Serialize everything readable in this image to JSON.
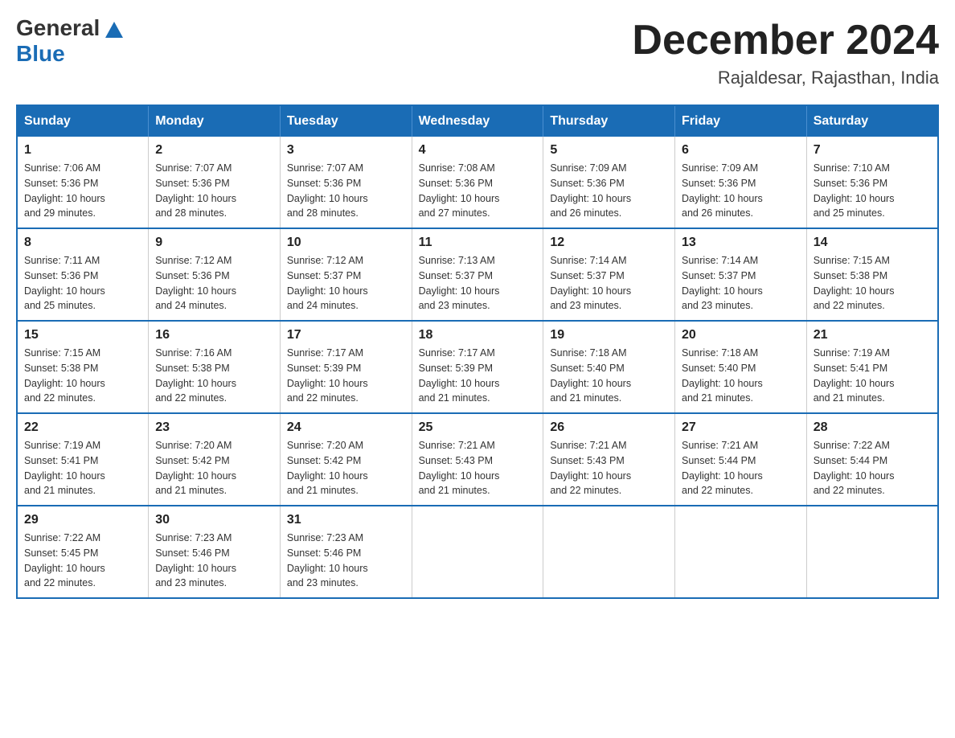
{
  "header": {
    "logo_general": "General",
    "logo_blue": "Blue",
    "month_year": "December 2024",
    "location": "Rajaldesar, Rajasthan, India"
  },
  "weekdays": [
    "Sunday",
    "Monday",
    "Tuesday",
    "Wednesday",
    "Thursday",
    "Friday",
    "Saturday"
  ],
  "weeks": [
    [
      {
        "day": "1",
        "sunrise": "7:06 AM",
        "sunset": "5:36 PM",
        "daylight": "10 hours and 29 minutes."
      },
      {
        "day": "2",
        "sunrise": "7:07 AM",
        "sunset": "5:36 PM",
        "daylight": "10 hours and 28 minutes."
      },
      {
        "day": "3",
        "sunrise": "7:07 AM",
        "sunset": "5:36 PM",
        "daylight": "10 hours and 28 minutes."
      },
      {
        "day": "4",
        "sunrise": "7:08 AM",
        "sunset": "5:36 PM",
        "daylight": "10 hours and 27 minutes."
      },
      {
        "day": "5",
        "sunrise": "7:09 AM",
        "sunset": "5:36 PM",
        "daylight": "10 hours and 26 minutes."
      },
      {
        "day": "6",
        "sunrise": "7:09 AM",
        "sunset": "5:36 PM",
        "daylight": "10 hours and 26 minutes."
      },
      {
        "day": "7",
        "sunrise": "7:10 AM",
        "sunset": "5:36 PM",
        "daylight": "10 hours and 25 minutes."
      }
    ],
    [
      {
        "day": "8",
        "sunrise": "7:11 AM",
        "sunset": "5:36 PM",
        "daylight": "10 hours and 25 minutes."
      },
      {
        "day": "9",
        "sunrise": "7:12 AM",
        "sunset": "5:36 PM",
        "daylight": "10 hours and 24 minutes."
      },
      {
        "day": "10",
        "sunrise": "7:12 AM",
        "sunset": "5:37 PM",
        "daylight": "10 hours and 24 minutes."
      },
      {
        "day": "11",
        "sunrise": "7:13 AM",
        "sunset": "5:37 PM",
        "daylight": "10 hours and 23 minutes."
      },
      {
        "day": "12",
        "sunrise": "7:14 AM",
        "sunset": "5:37 PM",
        "daylight": "10 hours and 23 minutes."
      },
      {
        "day": "13",
        "sunrise": "7:14 AM",
        "sunset": "5:37 PM",
        "daylight": "10 hours and 23 minutes."
      },
      {
        "day": "14",
        "sunrise": "7:15 AM",
        "sunset": "5:38 PM",
        "daylight": "10 hours and 22 minutes."
      }
    ],
    [
      {
        "day": "15",
        "sunrise": "7:15 AM",
        "sunset": "5:38 PM",
        "daylight": "10 hours and 22 minutes."
      },
      {
        "day": "16",
        "sunrise": "7:16 AM",
        "sunset": "5:38 PM",
        "daylight": "10 hours and 22 minutes."
      },
      {
        "day": "17",
        "sunrise": "7:17 AM",
        "sunset": "5:39 PM",
        "daylight": "10 hours and 22 minutes."
      },
      {
        "day": "18",
        "sunrise": "7:17 AM",
        "sunset": "5:39 PM",
        "daylight": "10 hours and 21 minutes."
      },
      {
        "day": "19",
        "sunrise": "7:18 AM",
        "sunset": "5:40 PM",
        "daylight": "10 hours and 21 minutes."
      },
      {
        "day": "20",
        "sunrise": "7:18 AM",
        "sunset": "5:40 PM",
        "daylight": "10 hours and 21 minutes."
      },
      {
        "day": "21",
        "sunrise": "7:19 AM",
        "sunset": "5:41 PM",
        "daylight": "10 hours and 21 minutes."
      }
    ],
    [
      {
        "day": "22",
        "sunrise": "7:19 AM",
        "sunset": "5:41 PM",
        "daylight": "10 hours and 21 minutes."
      },
      {
        "day": "23",
        "sunrise": "7:20 AM",
        "sunset": "5:42 PM",
        "daylight": "10 hours and 21 minutes."
      },
      {
        "day": "24",
        "sunrise": "7:20 AM",
        "sunset": "5:42 PM",
        "daylight": "10 hours and 21 minutes."
      },
      {
        "day": "25",
        "sunrise": "7:21 AM",
        "sunset": "5:43 PM",
        "daylight": "10 hours and 21 minutes."
      },
      {
        "day": "26",
        "sunrise": "7:21 AM",
        "sunset": "5:43 PM",
        "daylight": "10 hours and 22 minutes."
      },
      {
        "day": "27",
        "sunrise": "7:21 AM",
        "sunset": "5:44 PM",
        "daylight": "10 hours and 22 minutes."
      },
      {
        "day": "28",
        "sunrise": "7:22 AM",
        "sunset": "5:44 PM",
        "daylight": "10 hours and 22 minutes."
      }
    ],
    [
      {
        "day": "29",
        "sunrise": "7:22 AM",
        "sunset": "5:45 PM",
        "daylight": "10 hours and 22 minutes."
      },
      {
        "day": "30",
        "sunrise": "7:23 AM",
        "sunset": "5:46 PM",
        "daylight": "10 hours and 23 minutes."
      },
      {
        "day": "31",
        "sunrise": "7:23 AM",
        "sunset": "5:46 PM",
        "daylight": "10 hours and 23 minutes."
      },
      null,
      null,
      null,
      null
    ]
  ],
  "labels": {
    "sunrise": "Sunrise:",
    "sunset": "Sunset:",
    "daylight": "Daylight:"
  }
}
